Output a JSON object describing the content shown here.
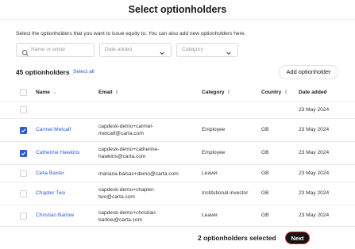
{
  "header": {
    "title": "Select optionholders"
  },
  "intro": "Select the optionholders that you want to issue equity to. You can also add new optionholders here.",
  "filters": {
    "search_placeholder": "Name or email",
    "date_placeholder": "Date added",
    "category_placeholder": "Category"
  },
  "summary": {
    "count_label": "45 optionholders",
    "select_all": "Select all",
    "add_button": "Add optionholder"
  },
  "table": {
    "columns": {
      "name": "Name",
      "email": "Email",
      "category": "Category",
      "country": "Country",
      "date_added": "Date added"
    },
    "rows": [
      {
        "checked": false,
        "name": "",
        "email_line1": "",
        "email_line2": "",
        "category": "",
        "country": "",
        "date": "23 May 2024"
      },
      {
        "checked": true,
        "name": "Carmel Metcalf",
        "email_line1": "capdesk-demo+carmel-",
        "email_line2": "metcalf@carta.com",
        "category": "Employee",
        "country": "GB",
        "date": "23 May 2024"
      },
      {
        "checked": true,
        "name": "Catherine Hawkins",
        "email_line1": "capdesk-demo+catherine-",
        "email_line2": "hawkins@carta.com",
        "category": "Employee",
        "country": "GB",
        "date": "23 May 2024"
      },
      {
        "checked": false,
        "name": "Celia Baxter",
        "email_line1": "mariana.balsas+demo@carta.com",
        "email_line2": "",
        "category": "Leaver",
        "country": "GB",
        "date": "23 May 2024"
      },
      {
        "checked": false,
        "name": "Chapter Two",
        "email_line1": "capdesk-demo+chapter-",
        "email_line2": "two@carta.com",
        "category": "Institutional investor",
        "country": "GB",
        "date": "23 May 2024"
      },
      {
        "checked": false,
        "name": "Christian Barlow",
        "email_line1": "capdesk-demo+christian-",
        "email_line2": "barlow@carta.com",
        "category": "Leaver",
        "country": "GB",
        "date": "23 May 2024"
      }
    ]
  },
  "footer": {
    "selected_label": "2 optionholders selected",
    "next_button": "Next"
  },
  "icons": {
    "search": "search-icon",
    "chevron": "chevron-down-icon",
    "sort": "sort-icon",
    "check": "check-icon"
  },
  "colors": {
    "link": "#2a5bd7",
    "checkbox_checked": "#2a5bd7",
    "primary_button": "#141414",
    "focus_ring": "#e0241b"
  }
}
